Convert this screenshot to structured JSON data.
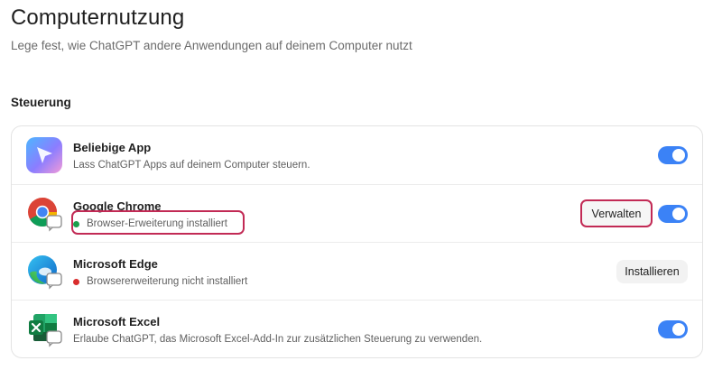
{
  "page": {
    "title": "Computernutzung",
    "subtitle": "Lege fest, wie ChatGPT andere Anwendungen auf deinem Computer nutzt"
  },
  "section": {
    "title": "Steuerung"
  },
  "apps": [
    {
      "name": "Beliebige App",
      "description": "Lass ChatGPT Apps auf deinem Computer steuern.",
      "icon": "chatgpt-cursor-icon",
      "toggle_on": true
    },
    {
      "name": "Google Chrome",
      "status": "Browser-Erweiterung installiert",
      "status_color": "#1a9e4b",
      "icon": "chrome-icon",
      "action_label": "Verwalten",
      "toggle_on": true
    },
    {
      "name": "Microsoft Edge",
      "status": "Browsererweiterung nicht installiert",
      "status_color": "#d92d2d",
      "icon": "edge-icon",
      "action_label": "Installieren"
    },
    {
      "name": "Microsoft Excel",
      "description": "Erlaube ChatGPT, das Microsoft Excel-Add-In zur zusätzlichen Steuerung zu verwenden.",
      "icon": "excel-icon",
      "toggle_on": true
    }
  ],
  "colors": {
    "toggle_on": "#3b82f6",
    "highlight": "#c22a55"
  }
}
